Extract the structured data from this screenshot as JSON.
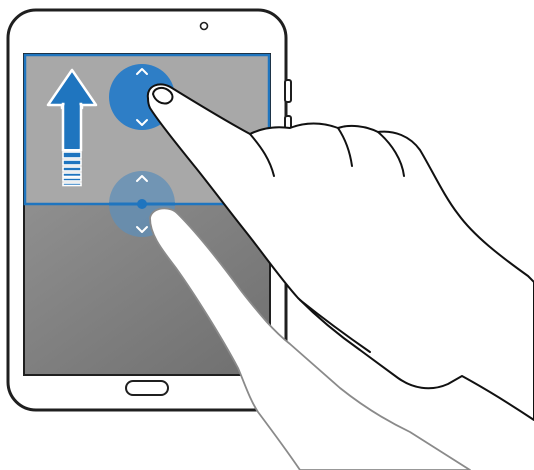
{
  "colors": {
    "tablet_body": "#ffffff",
    "tablet_outline": "#1f1f1f",
    "upper_pane": "#a8a8a8",
    "lower_pane_light": "#8f8f8f",
    "lower_pane_dark": "#6f6f6f",
    "active_border": "#1f75bf",
    "accent": "#1f75bf",
    "handle_fill": "#2e7ec6",
    "handle_faded": "#5f8fb8",
    "hand_outline": "#111111",
    "hand_fill": "#ffffff"
  },
  "icons": {
    "camera": "camera-dot",
    "home_button": "home-button",
    "arrow": "upward-arrow",
    "handle_up": "chevron-up-icon",
    "handle_down": "chevron-down-icon"
  },
  "illustration": {
    "panes": [
      "upper-window",
      "lower-window"
    ],
    "active_pane": "upper-window",
    "gesture": "drag-up"
  }
}
